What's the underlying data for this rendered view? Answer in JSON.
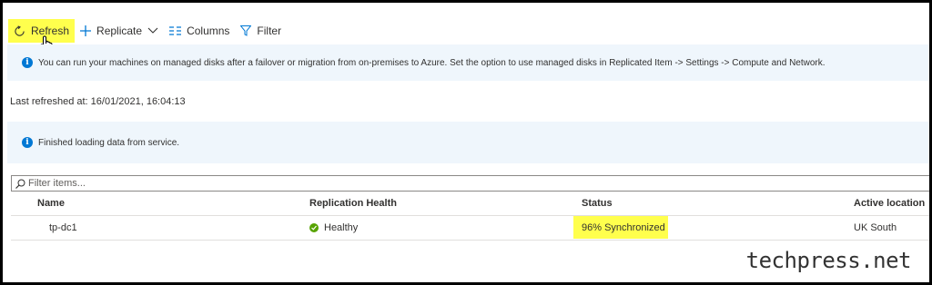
{
  "toolbar": {
    "refresh_label": "Refresh",
    "replicate_label": "Replicate",
    "columns_label": "Columns",
    "filter_label": "Filter"
  },
  "banners": {
    "managed_disks": "You can run your machines on managed disks after a failover or migration from on-premises to Azure. Set the option to use managed disks in Replicated Item -> Settings -> Compute and Network.",
    "loaded": "Finished loading data from service."
  },
  "last_refreshed": "Last refreshed at: 16/01/2021, 16:04:13",
  "filter": {
    "placeholder": "Filter items..."
  },
  "table": {
    "headers": [
      "Name",
      "Replication Health",
      "Status",
      "Active location"
    ],
    "rows": [
      {
        "name": "tp-dc1",
        "health": "Healthy",
        "status": "96% Synchronized",
        "location": "UK South"
      }
    ]
  },
  "watermark": "techpress.net",
  "colors": {
    "accent": "#0078d4",
    "highlight": "#ffff4d",
    "healthy": "#57a300",
    "banner_bg": "#eff6fc"
  },
  "icons": [
    "refresh-icon",
    "plus-icon",
    "chevron-down-icon",
    "columns-icon",
    "filter-icon",
    "info-icon",
    "search-icon",
    "check-circle-icon",
    "hand-cursor-icon"
  ]
}
